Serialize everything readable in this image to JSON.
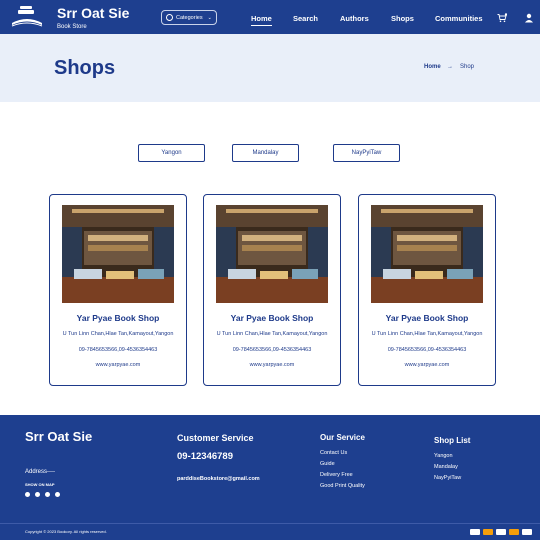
{
  "header": {
    "brand": "Srr Oat Sie",
    "brand_sub": "Book Store",
    "categories_label": "Categories",
    "nav": [
      "Home",
      "Search",
      "Authors",
      "Shops",
      "Communities"
    ]
  },
  "banner": {
    "title": "Shops",
    "crumb_home": "Home",
    "crumb_arrow": "→",
    "crumb_current": "Shop"
  },
  "cities": [
    "Yangon",
    "Mandalay",
    "NayPyiTaw"
  ],
  "shops": [
    {
      "name": "Yar Pyae Book Shop",
      "address": "U Tun Linn Chan,Hlae Tan,Kamayout,Yangon",
      "phone": "09-7845653566,09-4536354463",
      "web": "www.yarpyae.com"
    },
    {
      "name": "Yar Pyae Book Shop",
      "address": "U Tun Linn Chan,Hlae Tan,Kamayout,Yangon",
      "phone": "09-7845653566,09-4536354463",
      "web": "www.yarpyae.com"
    },
    {
      "name": "Yar Pyae Book Shop",
      "address": "U Tun Linn Chan,Hlae Tan,Kamayout,Yangon",
      "phone": "09-7845653566,09-4536354463",
      "web": "www.yarpyae.com"
    }
  ],
  "footer": {
    "brand": "Srr Oat Sie",
    "address": "Address----",
    "show_on_map": "SHOW ON MAP",
    "customer_service": "Customer Service",
    "phone": "09-12346789",
    "email": "parddiseBookstore@gmail.com",
    "our_service": "Our Service",
    "services": [
      "Contact Us",
      "Guide",
      "Delivery Free",
      "Good Print Quality"
    ],
    "shop_list_title": "Shop List",
    "shop_list": [
      "Yangon",
      "Mandalay",
      "NayPyiTaw"
    ],
    "copyright": "Copyright © 2023 Bookory. All rights reserved."
  },
  "colors": {
    "primary": "#1e3f8f",
    "banner_bg": "#e9eff9",
    "text": "#1e3a8a"
  }
}
